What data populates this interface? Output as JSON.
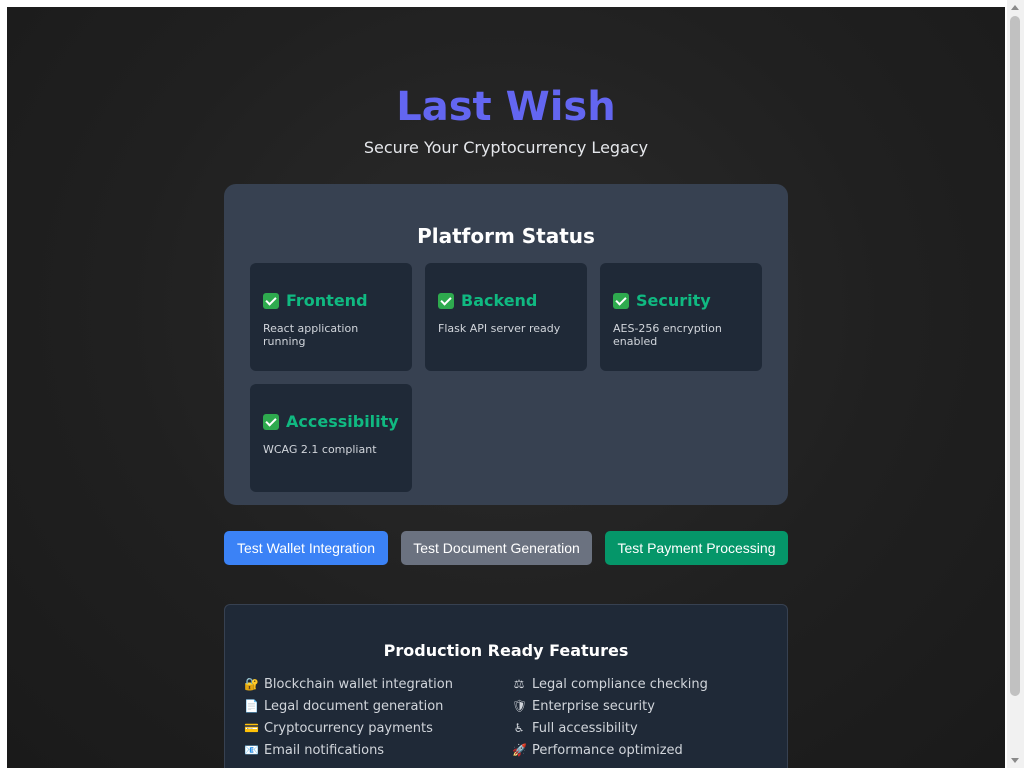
{
  "header": {
    "title": "Last Wish",
    "subtitle": "Secure Your Cryptocurrency Legacy"
  },
  "status": {
    "title": "Platform Status",
    "cards": [
      {
        "label": "Frontend",
        "desc": "React application running",
        "icon": "check-mark-icon"
      },
      {
        "label": "Backend",
        "desc": "Flask API server ready",
        "icon": "check-mark-icon"
      },
      {
        "label": "Security",
        "desc": "AES-256 encryption enabled",
        "icon": "check-mark-icon"
      },
      {
        "label": "Accessibility",
        "desc": "WCAG 2.1 compliant",
        "icon": "check-mark-icon"
      }
    ]
  },
  "actions": {
    "wallet_label": "Test Wallet Integration",
    "document_label": "Test Document Generation",
    "payment_label": "Test Payment Processing"
  },
  "features": {
    "title": "Production Ready Features",
    "items": [
      {
        "label": "Blockchain wallet integration",
        "icon": "lock-key-icon"
      },
      {
        "label": "Legal document generation",
        "icon": "document-icon"
      },
      {
        "label": "Cryptocurrency payments",
        "icon": "credit-card-icon"
      },
      {
        "label": "Email notifications",
        "icon": "email-icon"
      },
      {
        "label": "Legal compliance checking",
        "icon": "scales-icon"
      },
      {
        "label": "Enterprise security",
        "icon": "shield-icon"
      },
      {
        "label": "Full accessibility",
        "icon": "accessibility-icon"
      },
      {
        "label": "Performance optimized",
        "icon": "rocket-icon"
      }
    ]
  },
  "colors": {
    "accent": "#6366f1",
    "success": "#10b981",
    "primary_button": "#3b82f6",
    "secondary_button": "#6b7280",
    "success_button": "#059669"
  }
}
